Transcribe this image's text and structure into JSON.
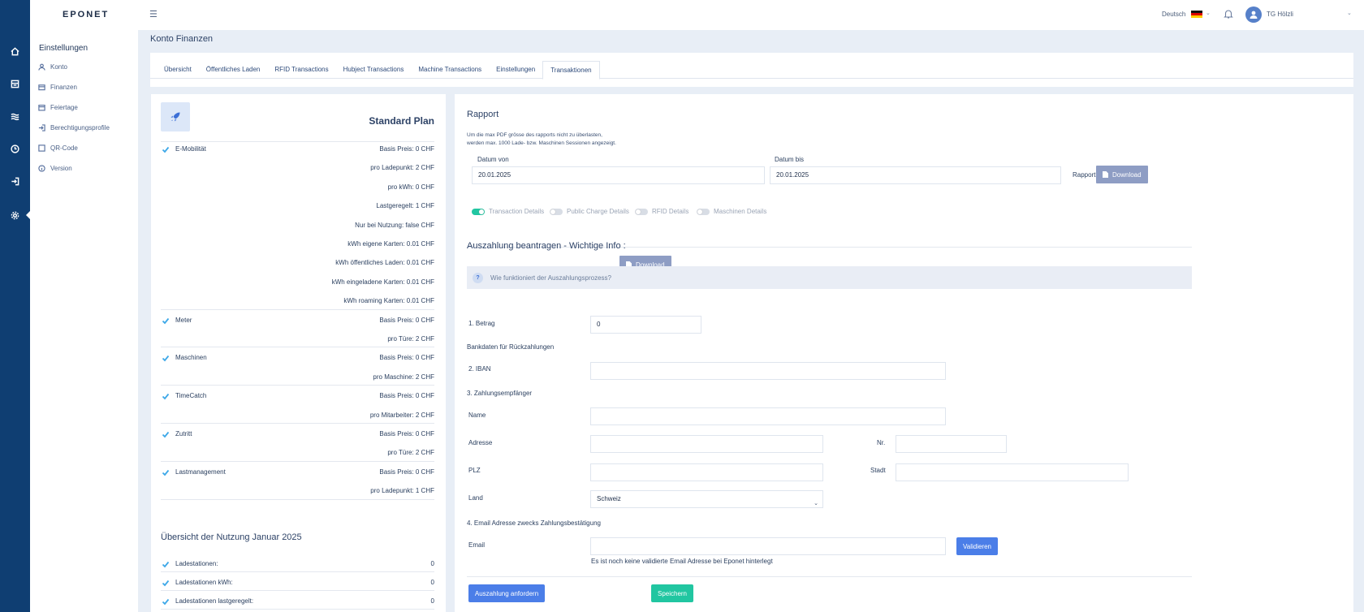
{
  "app": {
    "logo": "EPONET"
  },
  "topbar": {
    "language": "Deutsch",
    "user_name": "TG Hölzli"
  },
  "sidebar": {
    "title": "Einstellungen",
    "items": [
      {
        "label": "Konto",
        "icon": "user-icon"
      },
      {
        "label": "Finanzen",
        "icon": "wallet-icon",
        "active": true
      },
      {
        "label": "Feiertage",
        "icon": "calendar-icon"
      },
      {
        "label": "Berechtigungsprofile",
        "icon": "login-icon"
      },
      {
        "label": "QR-Code",
        "icon": "qr-icon"
      },
      {
        "label": "Version",
        "icon": "info-icon"
      }
    ]
  },
  "page": {
    "title": "Konto Finanzen"
  },
  "tabs": [
    {
      "label": "Übersicht"
    },
    {
      "label": "Öffentliches Laden"
    },
    {
      "label": "RFID Transactions"
    },
    {
      "label": "Hubject Transactions"
    },
    {
      "label": "Machine Transactions"
    },
    {
      "label": "Einstellungen"
    },
    {
      "label": "Transaktionen",
      "active": true
    }
  ],
  "plan": {
    "name": "Standard Plan",
    "features": [
      {
        "name": "E-Mobilität",
        "rows": [
          "Basis Preis: 0 CHF",
          "pro Ladepunkt: 2 CHF",
          "pro kWh: 0 CHF",
          "Lastgeregelt: 1 CHF",
          "Nur bei Nutzung: false CHF",
          "kWh eigene Karten: 0.01 CHF",
          "kWh öffentliches Laden: 0.01 CHF",
          "kWh eingeladene Karten: 0.01 CHF",
          "kWh roaming Karten: 0.01 CHF"
        ]
      },
      {
        "name": "Meter",
        "rows": [
          "Basis Preis: 0 CHF",
          "pro Türe: 2 CHF"
        ]
      },
      {
        "name": "Maschinen",
        "rows": [
          "Basis Preis: 0 CHF",
          "pro Maschine: 2 CHF"
        ]
      },
      {
        "name": "TimeCatch",
        "rows": [
          "Basis Preis: 0 CHF",
          "pro Mitarbeiter: 2 CHF"
        ]
      },
      {
        "name": "Zutritt",
        "rows": [
          "Basis Preis: 0 CHF",
          "pro Türe: 2 CHF"
        ]
      },
      {
        "name": "Lastmanagement",
        "rows": [
          "Basis Preis: 0 CHF",
          "pro Ladepunkt: 1 CHF"
        ]
      }
    ],
    "usage_title": "Übersicht der Nutzung Januar 2025",
    "usage": [
      {
        "label": "Ladestationen:",
        "value": "0"
      },
      {
        "label": "Ladestationen kWh:",
        "value": "0"
      },
      {
        "label": "Ladestationen lastgeregelt:",
        "value": "0"
      }
    ]
  },
  "report": {
    "title": "Rapport",
    "note_line1": "Um die max PDF grösse des rapports nicht zu überlasten,",
    "note_line2": "werden max. 1000 Lade- bzw. Maschinen Sessionen angezeigt.",
    "date_from_label": "Datum von",
    "date_from": "20.01.2025",
    "date_to_label": "Datum bis",
    "date_to": "20.01.2025",
    "rapport_label": "Rapport",
    "download_label": "Download",
    "toggles": [
      {
        "label": "Transaction Details",
        "on": true
      },
      {
        "label": "Public Charge Details",
        "on": false
      },
      {
        "label": "RFID Details",
        "on": false
      },
      {
        "label": "Maschinen Details",
        "on": false
      }
    ]
  },
  "payout": {
    "title": "Auszahlung beantragen - Wichtige Info :",
    "download_label": "Download",
    "info_q": "?",
    "info_text": "Wie funktioniert der Auszahlungsprozess?",
    "amount_label": "1. Betrag",
    "amount_value": "0",
    "bank_heading": "Bankdaten für Rückzahlungen",
    "iban_label": "2. IBAN",
    "iban_value": "",
    "recipient_heading": "3. Zahlungsempfänger",
    "name_label": "Name",
    "address_label": "Adresse",
    "nr_label": "Nr.",
    "plz_label": "PLZ",
    "city_label": "Stadt",
    "country_label": "Land",
    "country_value": "Schweiz",
    "email_heading": "4. Email Adresse zwecks Zahlungsbestätigung",
    "email_label": "Email",
    "validate_label": "Validieren",
    "email_hint": "Es ist noch keine validierte Email Adresse bei Eponet hinterlegt",
    "request_label": "Auszahlung anfordern",
    "save_label": "Speichern"
  },
  "colors": {
    "rail": "#0f3e72",
    "accent": "#4b7ee8",
    "success": "#21c6a1",
    "muted_button": "#8e9dc4"
  }
}
